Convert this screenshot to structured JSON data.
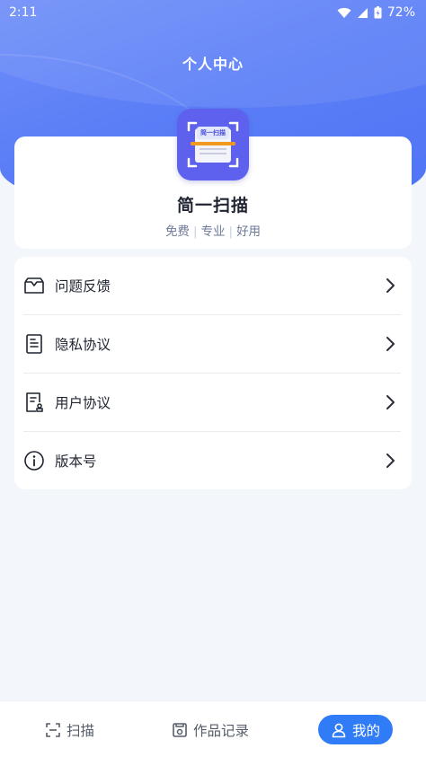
{
  "status_bar": {
    "time": "2:11",
    "battery": "72%"
  },
  "header": {
    "title": "个人中心"
  },
  "profile": {
    "logo_text": "简一扫描",
    "app_name": "简一扫描",
    "tags": [
      "免费",
      "专业",
      "好用"
    ],
    "separator": "|"
  },
  "menu": {
    "items": [
      {
        "label": "问题反馈",
        "icon": "feedback-icon"
      },
      {
        "label": "隐私协议",
        "icon": "document-icon"
      },
      {
        "label": "用户协议",
        "icon": "agreement-icon"
      },
      {
        "label": "版本号",
        "icon": "info-icon"
      }
    ]
  },
  "bottom_nav": {
    "items": [
      {
        "label": "扫描",
        "icon": "scan-icon"
      },
      {
        "label": "作品记录",
        "icon": "records-icon"
      },
      {
        "label": "我的",
        "icon": "user-icon"
      }
    ],
    "active_index": 2
  },
  "colors": {
    "accent": "#2f7cf6",
    "header_blue": "#5b7ef7",
    "logo_purple": "#5e61ee",
    "logo_orange": "#f29a1f"
  }
}
